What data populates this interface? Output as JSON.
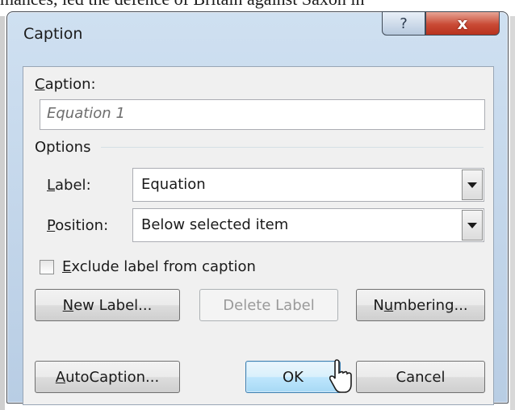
{
  "background": {
    "document_text": "mances, led the defence of Britain against Saxon in"
  },
  "window": {
    "title": "Caption",
    "help_glyph": "?",
    "close_glyph": "x"
  },
  "caption": {
    "label": "Caption:",
    "label_mnemonic": "C",
    "label_rest": "aption:",
    "value": "Equation 1"
  },
  "options": {
    "group_label": "Options",
    "label_field": {
      "mnemonic": "L",
      "rest": "abel:",
      "selected": "Equation"
    },
    "position_field": {
      "mnemonic": "P",
      "rest": "osition:",
      "selected": "Below selected item"
    }
  },
  "exclude_label": {
    "mnemonic": "E",
    "rest": "xclude label from caption",
    "checked": false
  },
  "buttons": {
    "new_label": {
      "mnemonic": "N",
      "rest": "ew Label..."
    },
    "delete_label": {
      "label": "Delete Label",
      "enabled": false
    },
    "numbering": {
      "pre": "N",
      "mnemonic": "u",
      "rest": "mbering..."
    },
    "autocaption": {
      "mnemonic": "A",
      "rest": "utoCaption..."
    },
    "ok": {
      "label": "OK",
      "is_default": true
    },
    "cancel": {
      "label": "Cancel"
    }
  },
  "icons": {
    "dropdown": "chevron-down-icon",
    "cursor": "pointer-cursor-icon"
  },
  "colors": {
    "window_frame": "#b8cde4",
    "close_button": "#c94a35",
    "client_bg": "#f0f0f0",
    "default_button": "#bee6fd"
  }
}
